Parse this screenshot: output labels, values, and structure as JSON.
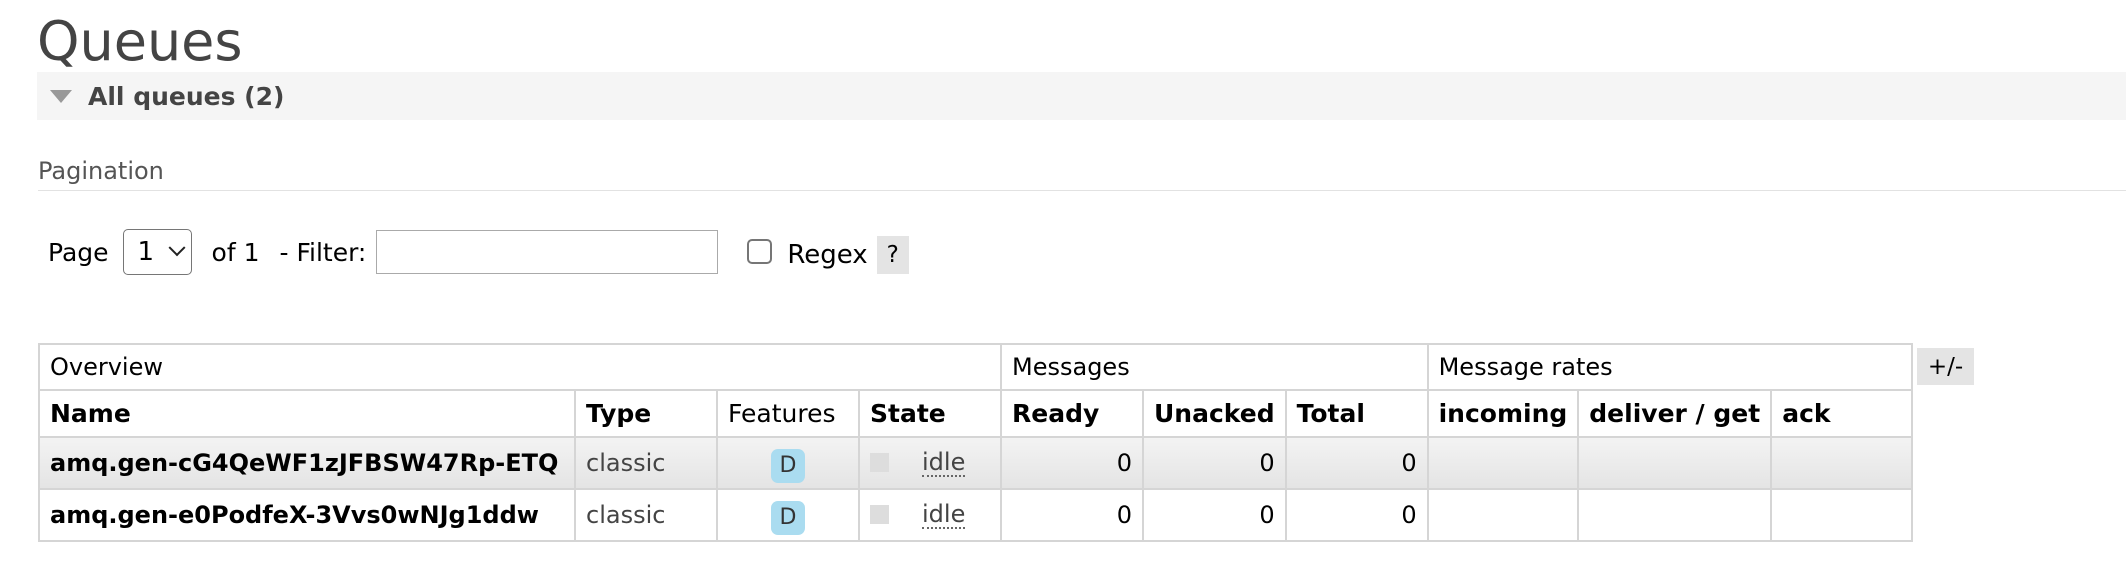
{
  "page": {
    "title": "Queues"
  },
  "section": {
    "title": "All queues (2)"
  },
  "pagination": {
    "title": "Pagination",
    "page_label": "Page",
    "page_value": "1",
    "of_label": "of 1",
    "filter_label": "- Filter:",
    "filter_value": "",
    "regex_label": "Regex",
    "help_label": "?"
  },
  "table": {
    "groups": [
      "Overview",
      "Messages",
      "Message rates"
    ],
    "columns": [
      "Name",
      "Type",
      "Features",
      "State",
      "Ready",
      "Unacked",
      "Total",
      "incoming",
      "deliver / get",
      "ack"
    ],
    "toggle_label": "+/-",
    "rows": [
      {
        "name": "amq.gen-cG4QeWF1zJFBSW47Rp-ETQ",
        "type": "classic",
        "feature": "D",
        "state": "idle",
        "ready": "0",
        "unacked": "0",
        "total": "0",
        "incoming": "",
        "deliver_get": "",
        "ack": ""
      },
      {
        "name": "amq.gen-e0PodfeX-3Vvs0wNJg1ddw",
        "type": "classic",
        "feature": "D",
        "state": "idle",
        "ready": "0",
        "unacked": "0",
        "total": "0",
        "incoming": "",
        "deliver_get": "",
        "ack": ""
      }
    ]
  }
}
